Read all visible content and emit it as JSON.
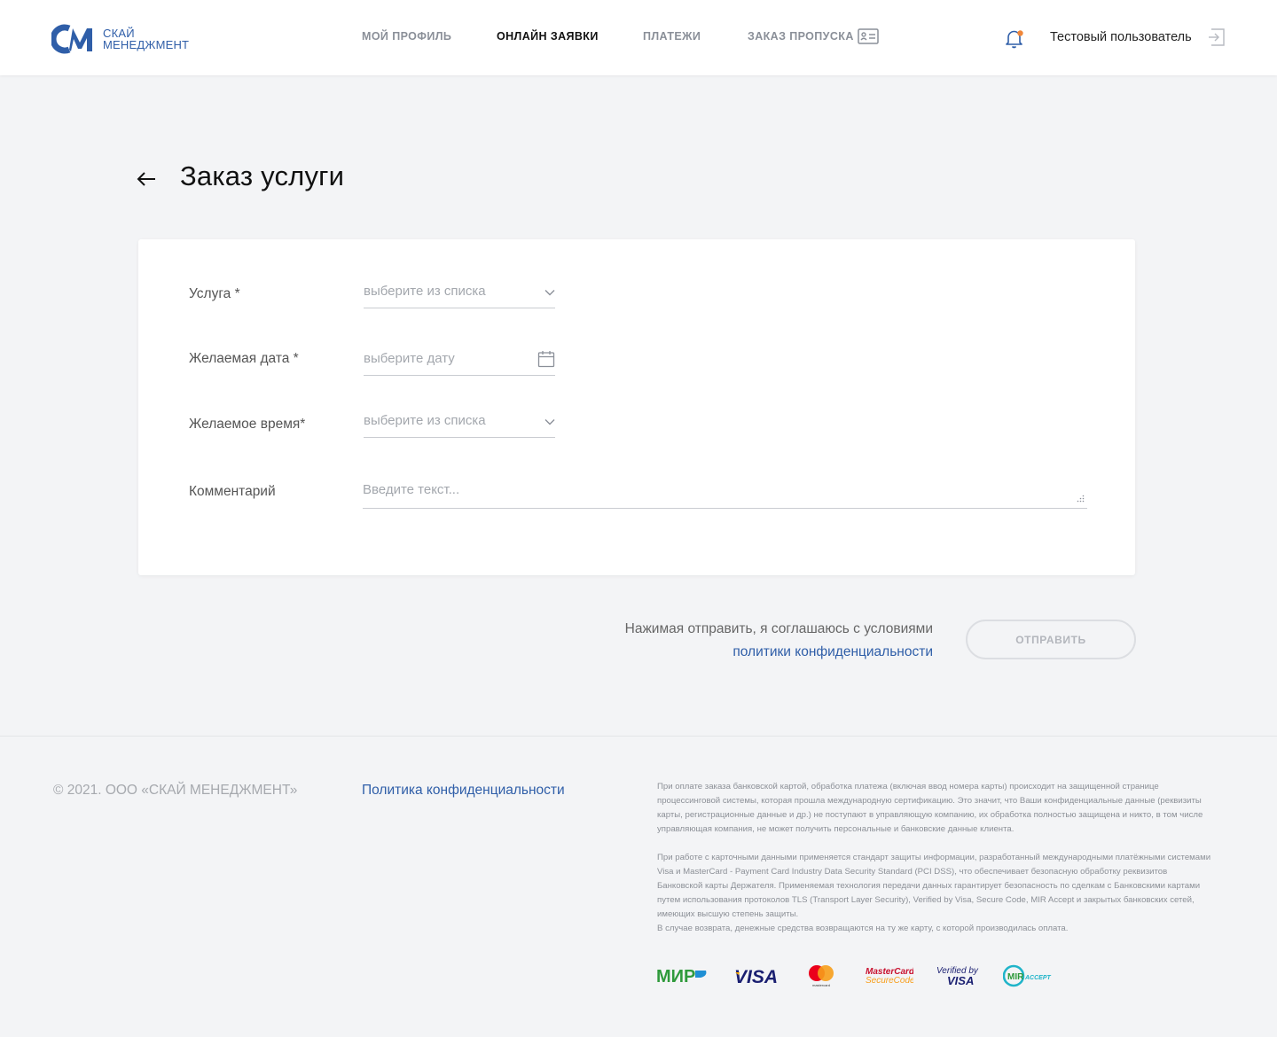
{
  "header": {
    "logo_line1": "СКАЙ",
    "logo_line2": "МЕНЕДЖМЕНТ",
    "nav": [
      {
        "label": "МОЙ ПРОФИЛЬ",
        "active": false
      },
      {
        "label": "ОНЛАЙН ЗАЯВКИ",
        "active": true
      },
      {
        "label": "ПЛАТЕЖИ",
        "active": false
      },
      {
        "label": "ЗАКАЗ ПРОПУСКА",
        "active": false
      }
    ],
    "username": "Тестовый пользователь",
    "notification_dot_color": "#f0873a",
    "brand_color": "#2f5ea8",
    "icons": [
      "id-card-icon",
      "bell-icon",
      "logout-icon"
    ]
  },
  "page": {
    "title": "Заказ услуги"
  },
  "form": {
    "service": {
      "label": "Услуга *",
      "placeholder": "выберите из списка"
    },
    "date": {
      "label": "Желаемая дата *",
      "placeholder": "выберите дату"
    },
    "time": {
      "label": "Желаемое время*",
      "placeholder": "выберите из списка"
    },
    "comment": {
      "label": "Комментарий",
      "placeholder": "Введите текст..."
    }
  },
  "submit": {
    "agree_text": "Нажимая отправить, я соглашаюсь с условиями",
    "agree_link": "политики конфиденциальности",
    "button_label": "ОТПРАВИТЬ"
  },
  "footer": {
    "copyright": "© 2021. ООО «СКАЙ МЕНЕДЖМЕНТ»",
    "policy_link": "Политика конфиденциальности",
    "legal_p1": "При оплате заказа банковской картой, обработка платежа (включая ввод номера карты) происходит на защищенной странице процессинговой системы, которая прошла международную сертификацию. Это значит, что Ваши конфиденциальные данные (реквизиты карты, регистрационные данные и др.) не поступают в управляющую компанию, их обработка полностью защищена и никто, в том числе управляющая компания, не может получить персональные и банковские данные клиента.",
    "legal_p2": "При работе с карточными данными применяется стандарт защиты информации, разработанный международными платёжными системами Visa и MasterCard - Payment Card Industry Data Security Standard (PCI DSS), что обеспечивает безопасную обработку реквизитов Банковской карты Держателя. Применяемая технология передачи данных гарантирует безопасность по сделкам с Банковскими картами путем использования протоколов TLS (Transport Layer Security), Verified by Visa, Secure Code, MIR Accept и закрытых банковских сетей, имеющих высшую степень защиты.",
    "legal_p3": "В случае возврата, денежные средства возвращаются на ту же карту, с которой производилась оплата.",
    "payment_logos": {
      "mir": "МИР",
      "visa": "VISA",
      "mastercard": "mastercard",
      "mc_secure_1": "MasterCard.",
      "mc_secure_2": "SecureCode.",
      "vbv_1": "Verified by",
      "vbv_2": "VISA",
      "mir_accept_1": "MIR",
      "mir_accept_2": "ACCEPT"
    }
  }
}
